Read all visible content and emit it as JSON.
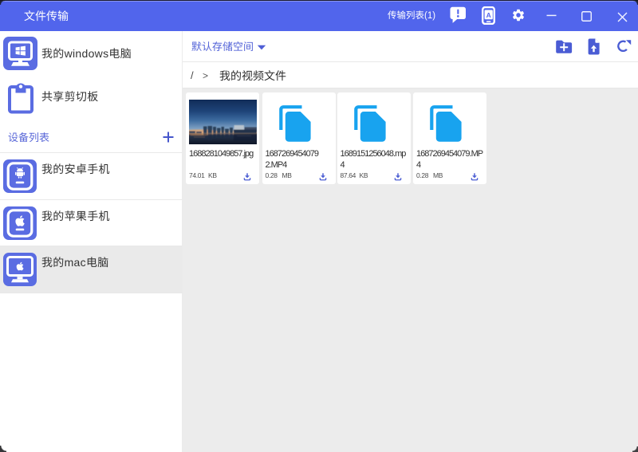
{
  "titlebar": {
    "title": "文件传输",
    "transfer_list_label": "传输列表(1)"
  },
  "sidebar": {
    "computer_label": "我的windows电脑",
    "clipboard_label": "共享剪切板",
    "device_list_label": "设备列表",
    "devices": [
      {
        "label": "我的安卓手机",
        "type": "android-phone",
        "selected": false
      },
      {
        "label": "我的苹果手机",
        "type": "apple-phone",
        "selected": false
      },
      {
        "label": "我的mac电脑",
        "type": "mac-computer",
        "selected": true
      }
    ]
  },
  "toolbar": {
    "storage_label": "默认存储空间"
  },
  "breadcrumb": {
    "root": "/",
    "separator": ">",
    "current": "我的视频文件"
  },
  "files": [
    {
      "name": "1688281049857.jpg",
      "size_value": "74.01",
      "size_unit": "KB",
      "kind": "image"
    },
    {
      "name": "1687269454079 2.MP4",
      "size_value": "0.28",
      "size_unit": "MB",
      "kind": "video"
    },
    {
      "name": "1689151256048.mp4",
      "size_value": "87.64",
      "size_unit": "KB",
      "kind": "video"
    },
    {
      "name": "1687269454079.MP4",
      "size_value": "0.28",
      "size_unit": "MB",
      "kind": "video"
    }
  ],
  "colors": {
    "titlebar": "#5165ec",
    "sidebar_icon": "#5a6ce2",
    "accent_text": "#5565d8",
    "file_icon": "#18a3ef",
    "download_icon": "#4d5fd3",
    "content_bg": "#ececec",
    "selected_row": "#eaeaea"
  }
}
